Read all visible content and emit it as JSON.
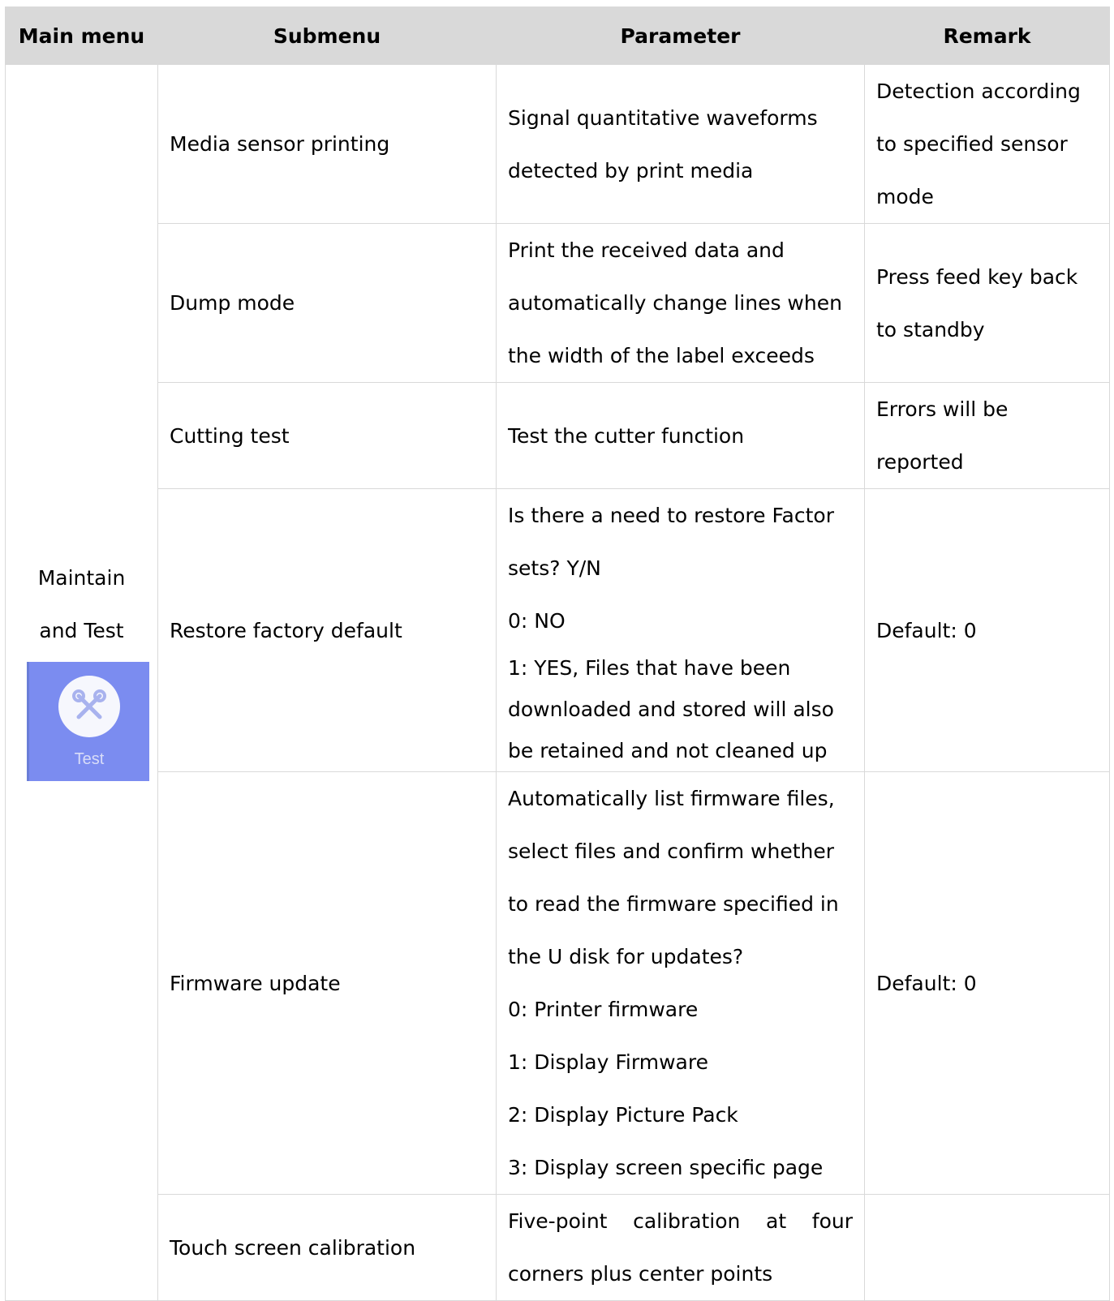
{
  "headers": {
    "main_menu": "Main menu",
    "submenu": "Submenu",
    "parameter": "Parameter",
    "remark": "Remark"
  },
  "main_menu": {
    "line1": "Maintain",
    "line2": "and Test",
    "icon_label": "Test",
    "icon_name": "tools-icon",
    "icon_color": "#7b8cf0"
  },
  "rows": [
    {
      "submenu": "Media sensor printing",
      "parameter": [
        "Signal quantitative waveforms",
        "detected by print media"
      ],
      "remark": [
        "Detection according",
        "to specified sensor",
        "mode"
      ]
    },
    {
      "submenu": "Dump mode",
      "parameter": [
        "Print the received data and",
        "automatically change lines when",
        "the width of the label exceeds"
      ],
      "remark": [
        "Press feed key back",
        "to standby"
      ]
    },
    {
      "submenu": "Cutting test",
      "parameter": [
        "Test the cutter function"
      ],
      "remark": [
        "Errors will be",
        "reported"
      ]
    },
    {
      "submenu": "Restore factory default",
      "parameter": [
        "Is there a need to restore Factor",
        "sets? Y/N",
        "0: NO",
        "1: YES, Files that have been",
        "downloaded and stored will also",
        "be retained and not cleaned up"
      ],
      "remark": [
        "Default: 0"
      ]
    },
    {
      "submenu": "Firmware update",
      "parameter": [
        "Automatically list firmware files,",
        "select files and confirm whether",
        "to read the firmware specified in",
        "the U disk for updates?",
        "0: Printer firmware",
        "1: Display Firmware",
        "2: Display Picture Pack",
        "3: Display screen specific page"
      ],
      "remark": [
        "Default: 0"
      ]
    },
    {
      "submenu": "Touch screen calibration",
      "parameter": [
        "Five-point calibration at four",
        "corners plus center points"
      ],
      "remark": []
    }
  ]
}
